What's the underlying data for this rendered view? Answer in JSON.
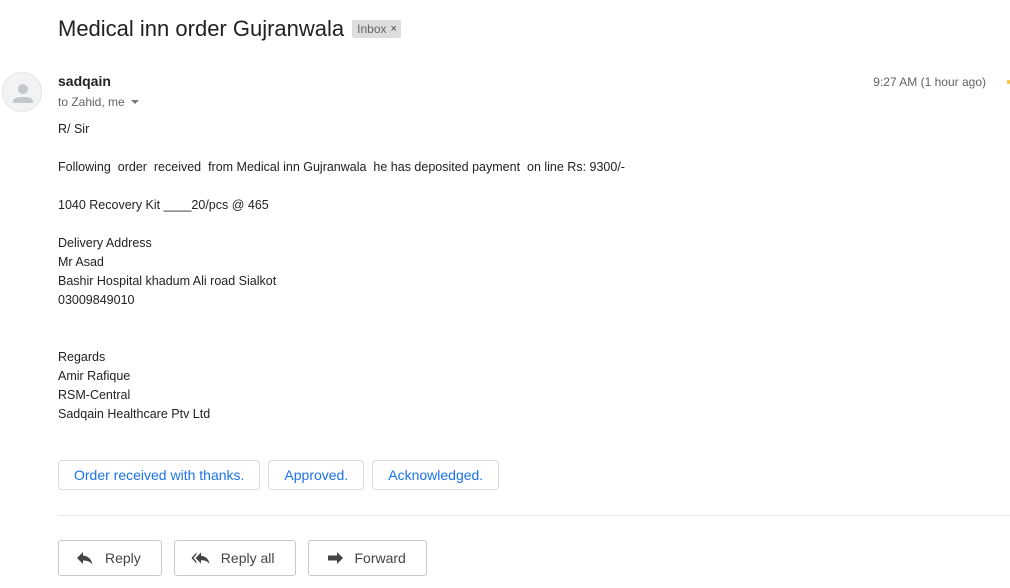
{
  "email": {
    "subject": "Medical inn order Gujranwala",
    "label": "Inbox",
    "label_remove": "×",
    "sender": "sadqain",
    "recipients": "to Zahid, me",
    "timestamp": "9:27 AM (1 hour ago)",
    "body_lines": [
      "R/ Sir",
      "",
      "Following  order  received  from Medical inn Gujranwala  he has deposited payment  on line Rs: 9300/-",
      "",
      "1040 Recovery Kit ____20/pcs @ 465",
      "",
      "Delivery Address",
      "Mr Asad",
      "Bashir Hospital khadum Ali road Sialkot",
      "03009849010",
      "",
      "",
      "Regards",
      "Amir Rafique",
      "RSM-Central",
      "Sadqain Healthcare Ptv Ltd"
    ]
  },
  "smart_replies": [
    "Order received with thanks.",
    "Approved.",
    "Acknowledged."
  ],
  "actions": {
    "reply": "Reply",
    "reply_all": "Reply all",
    "forward": "Forward"
  },
  "icons": {
    "avatar": "person-icon",
    "reply": "reply-arrow-icon",
    "reply_all": "reply-all-arrow-icon",
    "forward": "forward-arrow-icon",
    "caret": "chevron-down-icon",
    "star": "star-icon"
  },
  "colors": {
    "link_blue": "#1a73e8",
    "chip_bg": "#dddddd",
    "meta_grey": "#5f6368"
  }
}
